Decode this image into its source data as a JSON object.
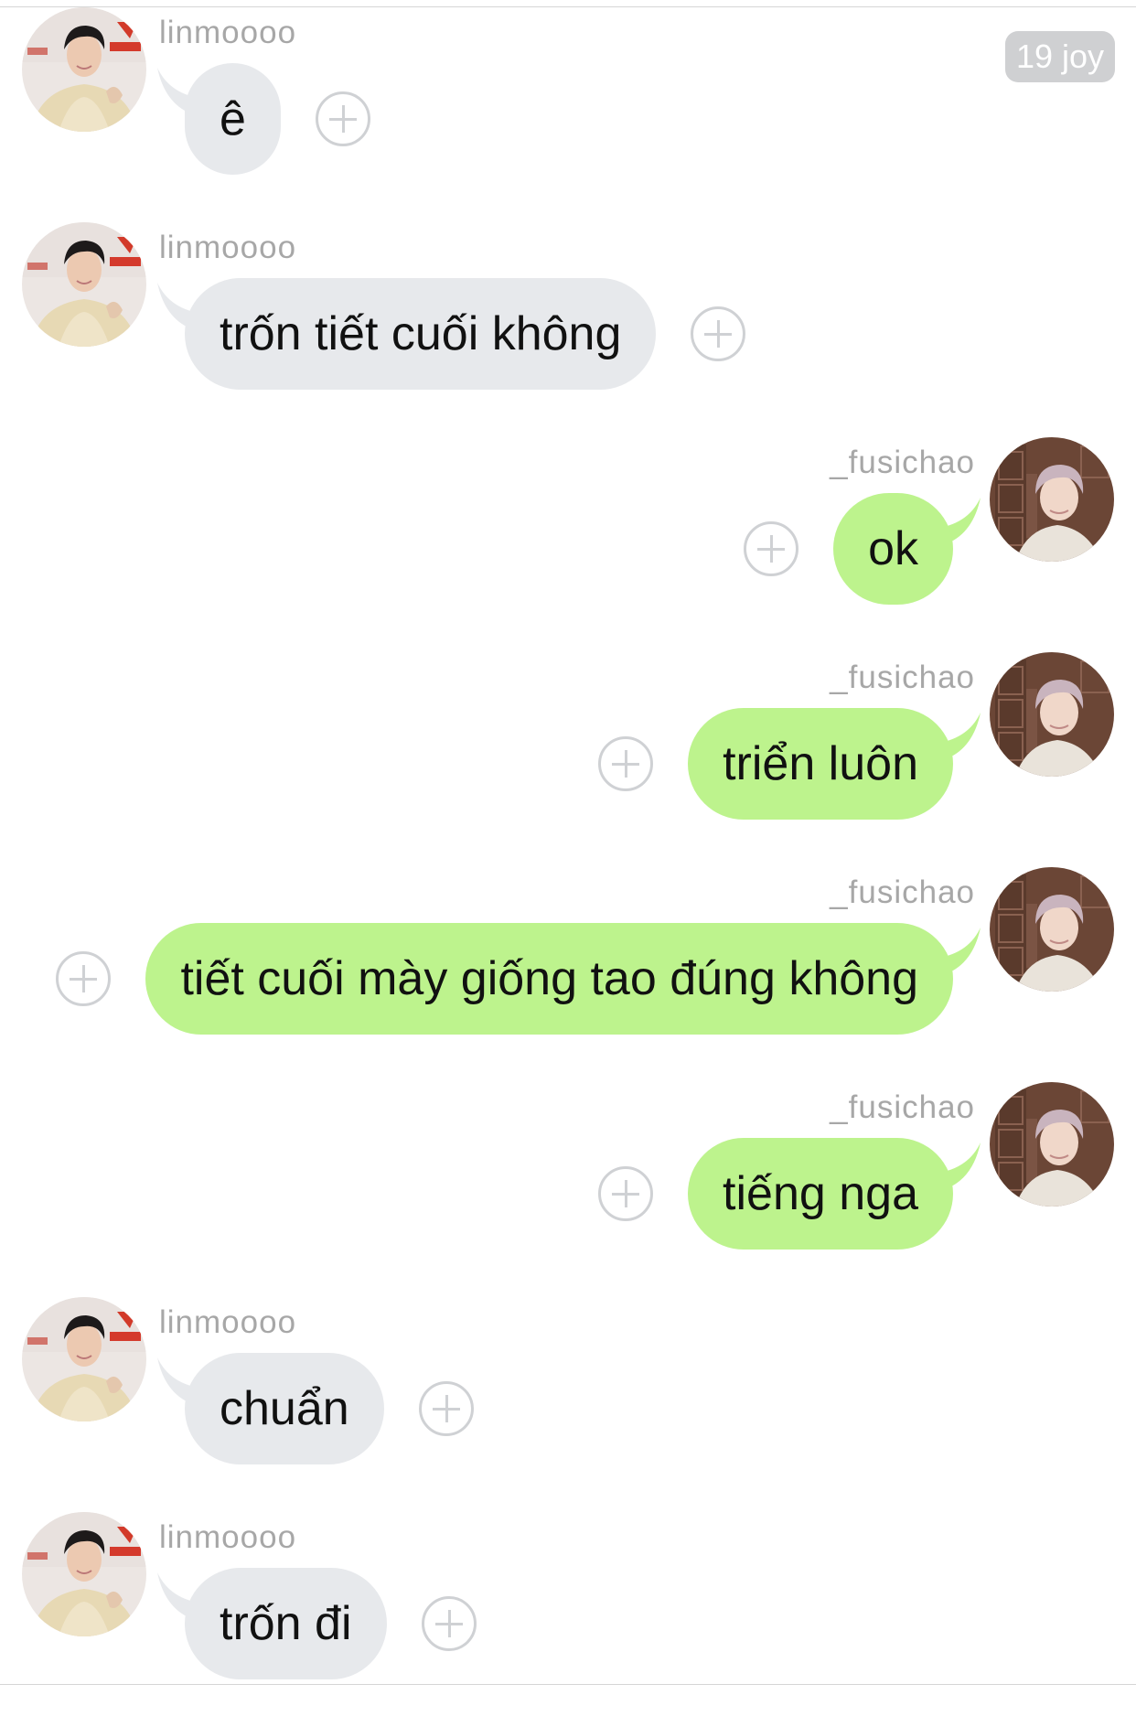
{
  "date_badge": "19 joy",
  "users": {
    "left": {
      "name": "linmoooo"
    },
    "right": {
      "name": "_fusichao"
    }
  },
  "messages": [
    {
      "side": "left",
      "sender": "linmoooo",
      "text": "ê"
    },
    {
      "side": "left",
      "sender": "linmoooo",
      "text": "trốn tiết cuối không"
    },
    {
      "side": "right",
      "sender": "_fusichao",
      "text": "ok"
    },
    {
      "side": "right",
      "sender": "_fusichao",
      "text": "triển luôn"
    },
    {
      "side": "right",
      "sender": "_fusichao",
      "text": "tiết cuối mày giống tao đúng không"
    },
    {
      "side": "right",
      "sender": "_fusichao",
      "text": "tiếng nga"
    },
    {
      "side": "left",
      "sender": "linmoooo",
      "text": "chuẩn"
    },
    {
      "side": "left",
      "sender": "linmoooo",
      "text": "trốn đi"
    }
  ],
  "colors": {
    "incoming_bubble": "#e7e9ec",
    "outgoing_bubble": "#bdf38d",
    "sender_text": "#a7a7a7",
    "add_button": "#cfd1d4"
  },
  "icons": {
    "add_reaction": "plus-circle-icon",
    "avatar_left": "user-photo-linmoooo",
    "avatar_right": "user-photo-fusichao"
  }
}
